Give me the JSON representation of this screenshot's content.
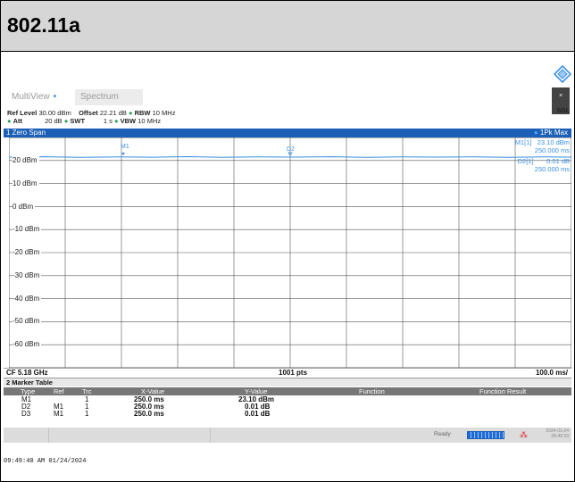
{
  "title": "802.11a",
  "tabs": [
    {
      "label": "MultiView"
    },
    {
      "label": "Spectrum"
    }
  ],
  "sgl": "SGL",
  "params": {
    "ref_level_label": "Ref Level",
    "ref_level_value": "30.00 dBm",
    "offset_label": "Offset",
    "offset_value": "22.21 dB",
    "rbw_label": "RBW",
    "rbw_value": "10 MHz",
    "att_label": "Att",
    "att_value": "20 dB",
    "swt_label": "SWT",
    "swt_value": "1 s",
    "vbw_label": "VBW",
    "vbw_value": "10 MHz"
  },
  "window": {
    "name": "1 Zero Span",
    "trace_mode": "1Pk Max"
  },
  "y_axis_labels": [
    "20 dBm",
    "10 dBm",
    "0 dBm",
    "-10 dBm",
    "-20 dBm",
    "-30 dBm",
    "-40 dBm",
    "-50 dBm",
    "-60 dBm"
  ],
  "markers_plot": {
    "m1": "M1",
    "d2": "D2"
  },
  "marker_info": {
    "m1_label": "M1[1]",
    "m1_value": "23.10 dBm",
    "m1_time": "250.000 ms",
    "d2_label": "D2[1]",
    "d2_value": "0.01 dB",
    "d2_time": "250.000 ms"
  },
  "cf_row": {
    "cf": "CF 5.18 GHz",
    "pts": "1001 pts",
    "div": "100.0 ms/"
  },
  "marker_table": {
    "title": "2 Marker Table",
    "headers": [
      "Type",
      "Ref",
      "Trc",
      "X-Value",
      "Y-Value",
      "Function",
      "Function Result"
    ],
    "rows": [
      {
        "type": "M1",
        "ref": "",
        "trc": "1",
        "x": "250.0 ms",
        "y": "23.10 dBm"
      },
      {
        "type": "D2",
        "ref": "M1",
        "trc": "1",
        "x": "250.0 ms",
        "y": "0.01 dB"
      },
      {
        "type": "D3",
        "ref": "M1",
        "trc": "1",
        "x": "250.0 ms",
        "y": "0.01 dB"
      }
    ]
  },
  "status": {
    "ready": "Ready",
    "date": "2024-01-24",
    "time": "09:49:39"
  },
  "timestamp": "09:49:40 AM 01/24/2024",
  "colors": {
    "accent": "#1b5fb7",
    "trace": "#3a8fe0",
    "header_bg": "#d6d6d6"
  },
  "icons": {
    "logo": "rohde-schwarz-logo-icon"
  }
}
